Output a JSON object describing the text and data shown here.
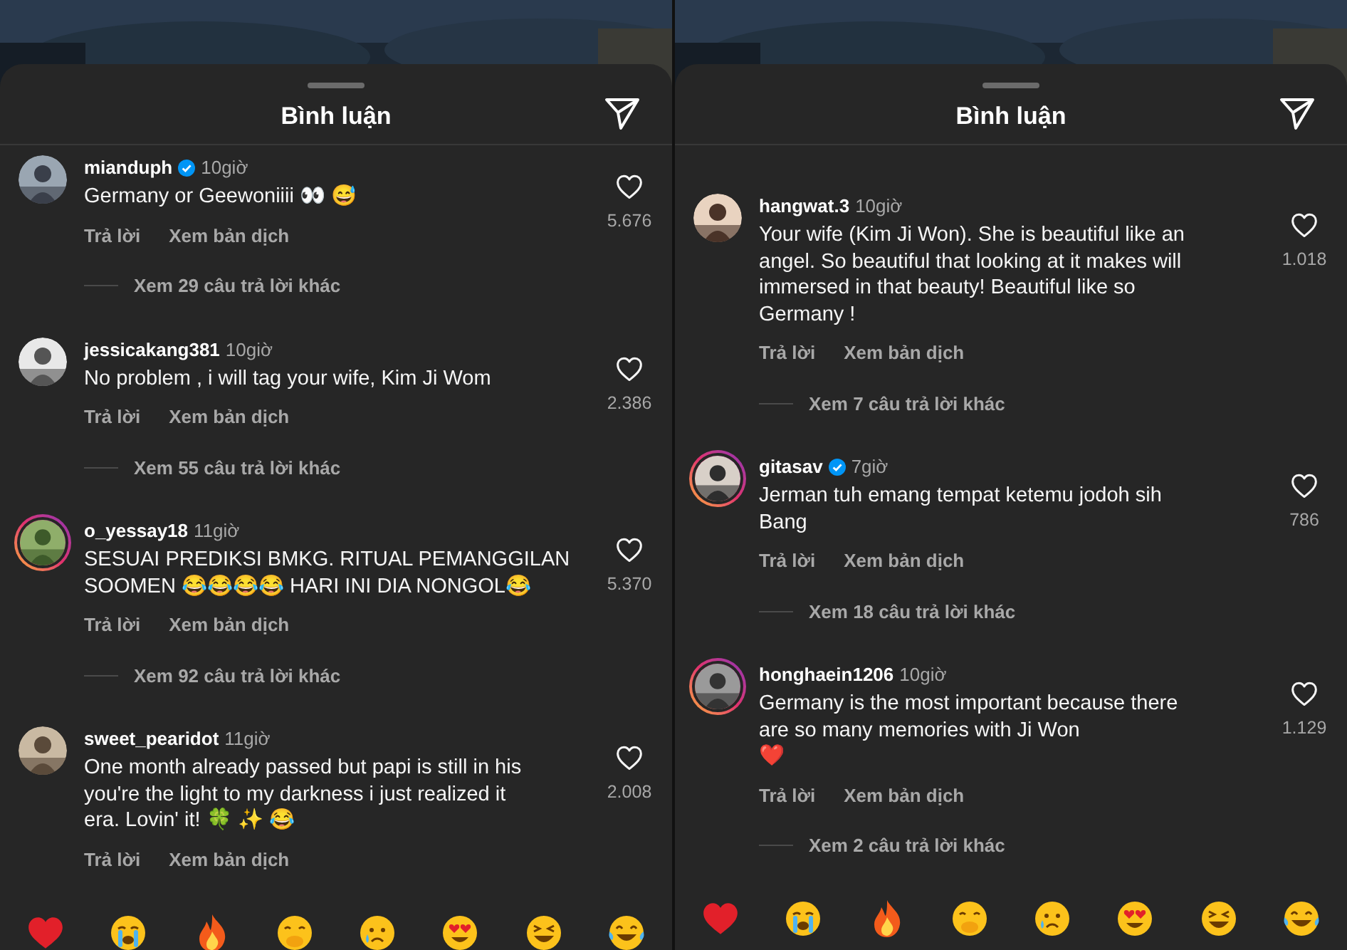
{
  "panels": [
    {
      "title": "Bình luận",
      "comments": [
        {
          "username": "mianduph",
          "verified": true,
          "time": "10giờ",
          "story_ring": false,
          "lines": [
            "Germany or Geewoniiii 👀 😅"
          ],
          "reply": "Trả lời",
          "translate": "Xem bản dịch",
          "likes": "5.676",
          "more_replies": "Xem 29 câu trả lời khác"
        },
        {
          "username": "jessicakang381",
          "verified": false,
          "time": "10giờ",
          "story_ring": false,
          "lines": [
            "No problem , i will tag your wife, Kim Ji Wom"
          ],
          "reply": "Trả lời",
          "translate": "Xem bản dịch",
          "likes": "2.386",
          "more_replies": "Xem 55 câu trả lời khác"
        },
        {
          "username": "o_yessay18",
          "verified": false,
          "time": "11giờ",
          "story_ring": true,
          "lines": [
            "SESUAI PREDIKSI BMKG. RITUAL PEMANGGILAN",
            "SOOMEN 😂😂😂😂 HARI INI DIA NONGOL😂"
          ],
          "reply": "Trả lời",
          "translate": "Xem bản dịch",
          "likes": "5.370",
          "more_replies": "Xem 92 câu trả lời khác"
        },
        {
          "username": "sweet_pearidot",
          "verified": false,
          "time": "11giờ",
          "story_ring": false,
          "lines": [
            "One month already passed but papi is still in his",
            "you're the light to my darkness i just realized it",
            "era. Lovin' it! 🍀 ✨ 😂"
          ],
          "reply": "Trả lời",
          "translate": "Xem bản dịch",
          "likes": "2.008"
        }
      ]
    },
    {
      "title": "Bình luận",
      "comments": [
        {
          "username": "hangwat.3",
          "verified": false,
          "time": "10giờ",
          "story_ring": false,
          "lines": [
            "Your wife (Kim Ji Won). She is beautiful like an",
            "angel. So beautiful that looking at it makes will",
            "immersed in that beauty! Beautiful like so",
            "Germany !"
          ],
          "reply": "Trả lời",
          "translate": "Xem bản dịch",
          "likes": "1.018",
          "more_replies": "Xem 7 câu trả lời khác"
        },
        {
          "username": "gitasav",
          "verified": true,
          "time": "7giờ",
          "story_ring": true,
          "lines": [
            "Jerman tuh emang tempat ketemu jodoh sih",
            "Bang"
          ],
          "reply": "Trả lời",
          "translate": "Xem bản dịch",
          "likes": "786",
          "more_replies": "Xem 18 câu trả lời khác"
        },
        {
          "username": "honghaein1206",
          "verified": false,
          "time": "10giờ",
          "story_ring": true,
          "lines": [
            "Germany is the most important because there",
            "are so many memories with Ji Won",
            "❤️"
          ],
          "reply": "Trả lời",
          "translate": "Xem bản dịch",
          "likes": "1.129",
          "more_replies": "Xem 2 câu trả lời khác"
        }
      ]
    }
  ]
}
